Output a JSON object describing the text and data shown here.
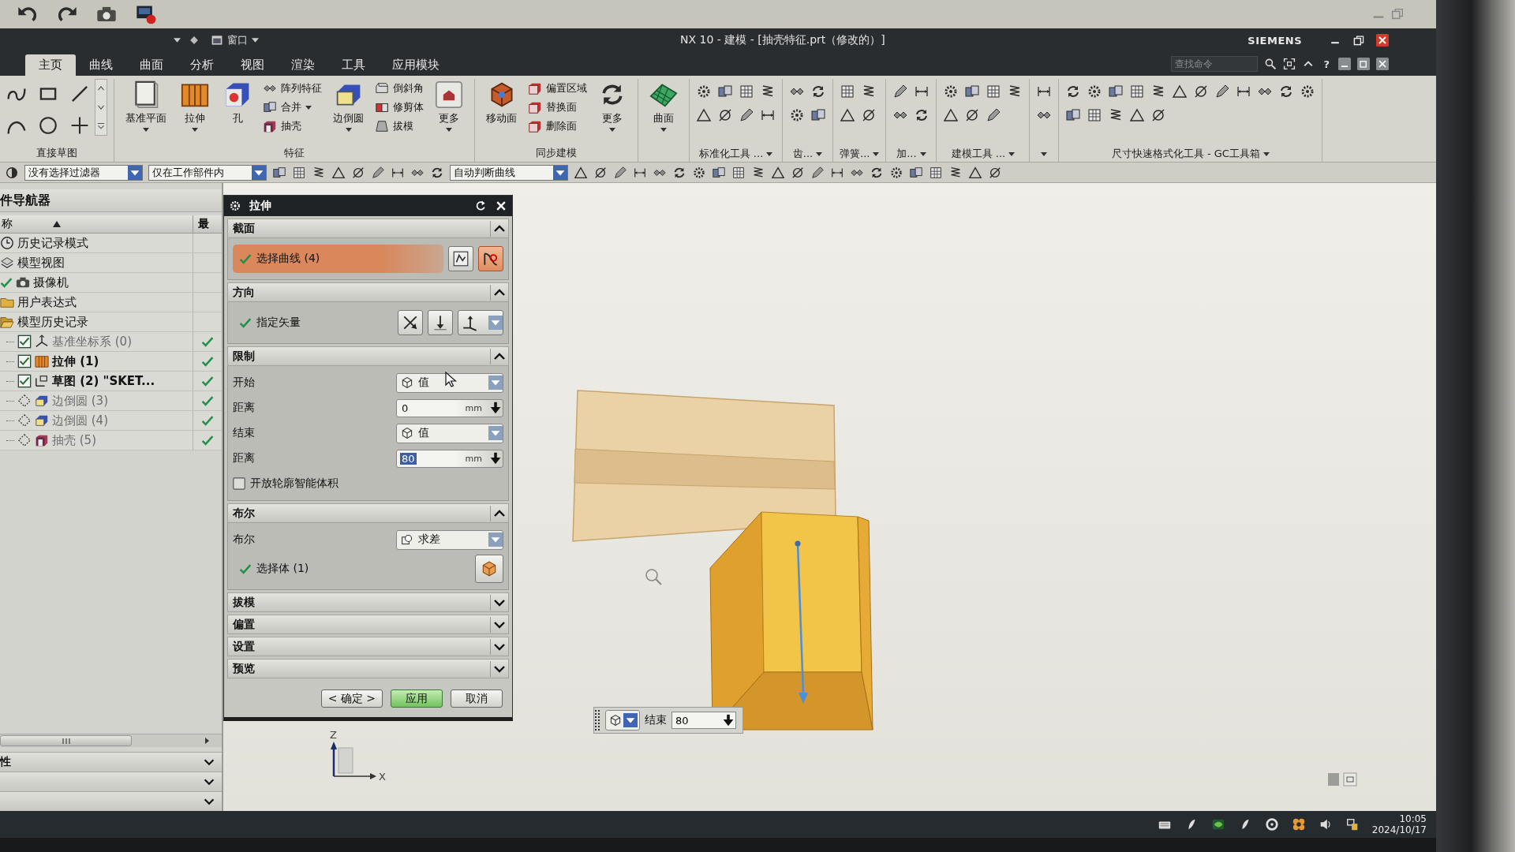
{
  "window": {
    "menu": "窗口",
    "title": "NX 10 - 建模 - [抽壳特征.prt（修改的）]",
    "brand": "SIEMENS",
    "search_placeholder": "查找命令",
    "help": "?"
  },
  "tabs": [
    {
      "label": "主页",
      "selected": true
    },
    {
      "label": "曲线",
      "selected": false
    },
    {
      "label": "曲面",
      "selected": false
    },
    {
      "label": "分析",
      "selected": false
    },
    {
      "label": "视图",
      "selected": false
    },
    {
      "label": "渲染",
      "selected": false
    },
    {
      "label": "工具",
      "selected": false
    },
    {
      "label": "应用模块",
      "selected": false
    }
  ],
  "ribbon": [
    {
      "kind": "sketch",
      "label": "直接草图"
    },
    {
      "kind": "buttons",
      "label": "特征",
      "items": [
        {
          "kind": "large",
          "label": "基准平面",
          "dropdown": true
        },
        {
          "kind": "large",
          "label": "拉伸",
          "dropdown": true
        },
        {
          "kind": "large",
          "label": "孔",
          "dropdown": false
        },
        {
          "kind": "stack",
          "items": [
            {
              "label": "阵列特征",
              "dropdown": false
            },
            {
              "label": "合并",
              "dropdown": true
            },
            {
              "label": "抽壳",
              "dropdown": false
            }
          ]
        },
        {
          "kind": "large",
          "label": "边倒圆",
          "dropdown": true
        },
        {
          "kind": "stack",
          "items": [
            {
              "label": "倒斜角",
              "dropdown": false
            },
            {
              "label": "修剪体",
              "dropdown": false
            },
            {
              "label": "拔模",
              "dropdown": false
            }
          ]
        },
        {
          "kind": "large",
          "label": "更多",
          "dropdown": true
        }
      ]
    },
    {
      "kind": "buttons",
      "label": "同步建模",
      "items": [
        {
          "kind": "large",
          "label": "移动面",
          "dropdown": false
        },
        {
          "kind": "stack",
          "items": [
            {
              "label": "偏置区域",
              "dropdown": false
            },
            {
              "label": "替换面",
              "dropdown": false
            },
            {
              "label": "删除面",
              "dropdown": false
            }
          ]
        },
        {
          "kind": "large",
          "label": "更多",
          "dropdown": true
        }
      ]
    },
    {
      "kind": "buttons",
      "items": [
        {
          "kind": "large",
          "label": "曲面",
          "dropdown": true
        }
      ]
    },
    {
      "kind": "tools",
      "label": "标准化工具 ..."
    },
    {
      "kind": "tools",
      "label": "齿..."
    },
    {
      "kind": "tools",
      "label": "弹簧..."
    },
    {
      "kind": "tools",
      "label": "加..."
    },
    {
      "kind": "tools",
      "label": "建模工具 ..."
    },
    {
      "kind": "tools"
    },
    {
      "kind": "tools",
      "label": "尺寸快速格式化工具 - GC工具箱"
    }
  ],
  "selection_bar": {
    "filters": [
      {
        "value": "没有选择过滤器"
      },
      {
        "value": "仅在工作部件内"
      }
    ],
    "curve_rule": "自动判断曲线"
  },
  "navigator": {
    "title": "件导航器",
    "columns": [
      "称",
      "最"
    ],
    "items": [
      {
        "label": "历史记录模式",
        "checked": false
      },
      {
        "label": "模型视图",
        "checked": false
      },
      {
        "label": "摄像机",
        "checked": true
      },
      {
        "label": "用户表达式",
        "checked": false
      },
      {
        "label": "模型历史记录",
        "checked": false,
        "children": [
          {
            "label": "基准坐标系 (0)",
            "checked": true,
            "dimmed": true,
            "latest": true
          },
          {
            "label": "拉伸 (1)",
            "checked": true,
            "dimmed": false,
            "latest": true
          },
          {
            "label": "草图 (2) \"SKET...",
            "checked": true,
            "dimmed": false,
            "latest": true
          },
          {
            "label": "边倒圆 (3)",
            "checked": false,
            "dimmed": true,
            "latest": true
          },
          {
            "label": "边倒圆 (4)",
            "checked": false,
            "dimmed": true,
            "latest": true
          },
          {
            "label": "抽壳 (5)",
            "checked": false,
            "dimmed": true,
            "latest": true
          }
        ]
      }
    ],
    "panels": [
      {
        "label": "性",
        "expanded": false
      },
      {
        "expanded": false
      },
      {
        "expanded": false
      }
    ]
  },
  "dialog": {
    "title": "拉伸",
    "sections": [
      {
        "title": "截面",
        "expanded": true,
        "rows": [
          {
            "kind": "curve_select",
            "label": "选择曲线 (4)",
            "done": true,
            "active": true
          }
        ]
      },
      {
        "title": "方向",
        "expanded": true,
        "rows": [
          {
            "kind": "vector",
            "label": "指定矢量",
            "done": true
          }
        ]
      },
      {
        "title": "限制",
        "expanded": true,
        "rows": [
          {
            "kind": "type_dropdown",
            "label": "开始",
            "value": "值"
          },
          {
            "kind": "number",
            "label": "距离",
            "value": "0",
            "unit": "mm",
            "selected": false
          },
          {
            "kind": "type_dropdown",
            "label": "结束",
            "value": "值"
          },
          {
            "kind": "number",
            "label": "距离",
            "value": "80",
            "unit": "mm",
            "selected": true
          },
          {
            "kind": "checkbox",
            "label": "开放轮廓智能体积",
            "checked": false
          }
        ]
      },
      {
        "title": "布尔",
        "expanded": true,
        "rows": [
          {
            "kind": "boolean_dropdown",
            "label": "布尔",
            "value": "求差"
          },
          {
            "kind": "body_select",
            "label": "选择体 (1)",
            "done": true
          }
        ]
      },
      {
        "title": "拔模",
        "expanded": false
      },
      {
        "title": "偏置",
        "expanded": false
      },
      {
        "title": "设置",
        "expanded": false
      },
      {
        "title": "预览",
        "expanded": false
      }
    ],
    "buttons": [
      {
        "label": "< 确定 >",
        "focused": false
      },
      {
        "label": "应用",
        "focused": true
      },
      {
        "label": "取消",
        "focused": false
      }
    ]
  },
  "mini_toolbar": {
    "label": "结束",
    "value": "80"
  },
  "triad": {
    "z": "Z",
    "x": "X"
  },
  "taskbar": {
    "time": "10:05",
    "date": "2024/10/17"
  }
}
